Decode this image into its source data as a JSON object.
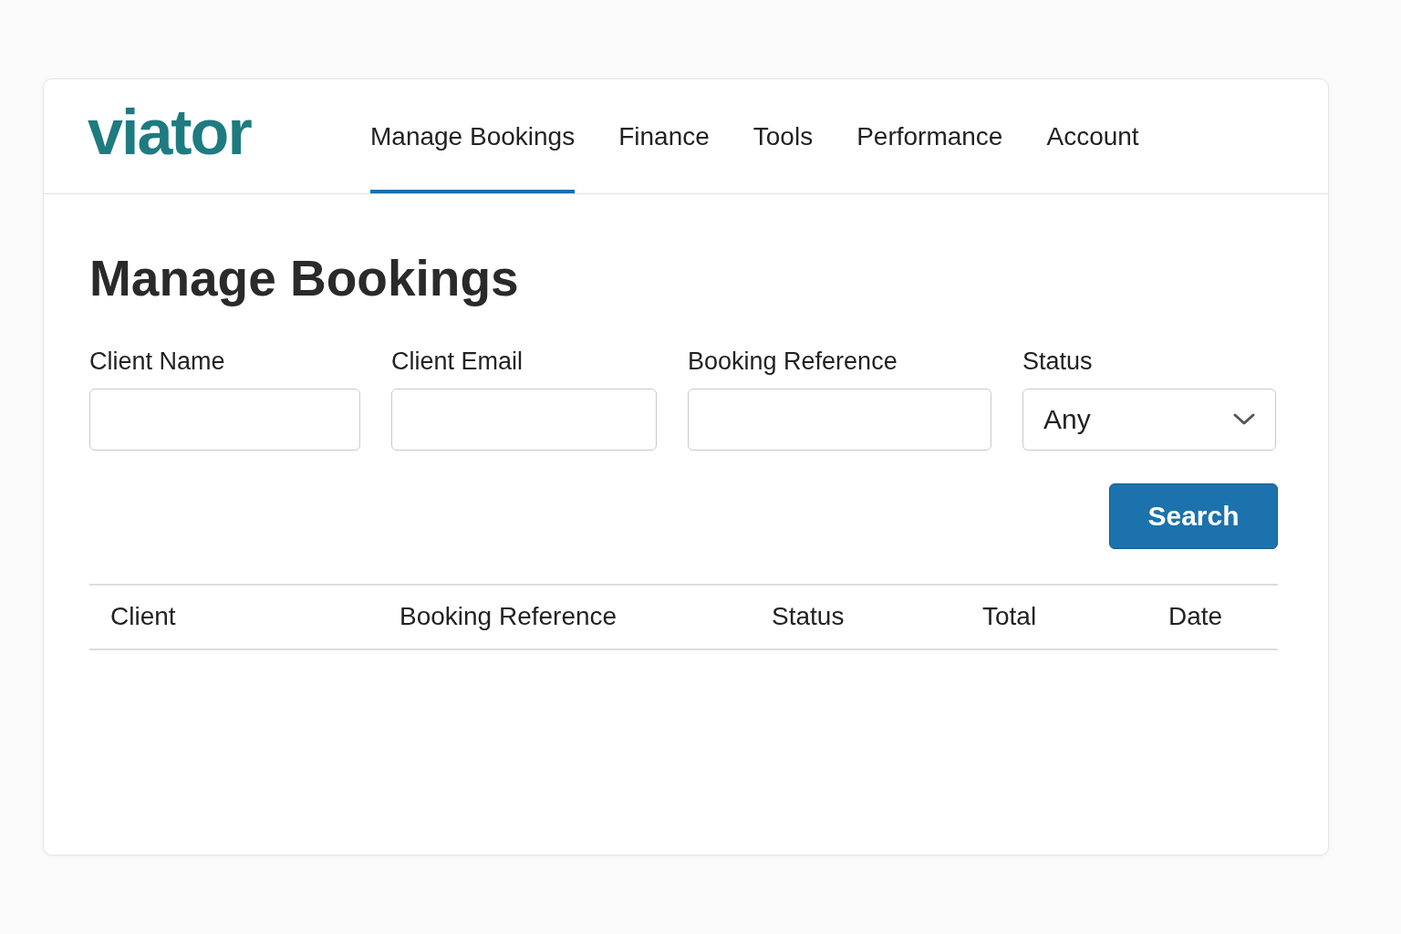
{
  "logo": "viator",
  "nav": [
    {
      "label": "Manage Bookings",
      "selected": true
    },
    {
      "label": "Finance",
      "selected": false
    },
    {
      "label": "Tools",
      "selected": false
    },
    {
      "label": "Performance",
      "selected": false
    },
    {
      "label": "Account",
      "selected": false
    }
  ],
  "title": "Manage Bookings",
  "filters": [
    {
      "kind": "text",
      "label": "Client Name"
    },
    {
      "kind": "text",
      "label": "Client Email"
    },
    {
      "kind": "text",
      "label": "Booking Reference"
    },
    {
      "kind": "select",
      "label": "Status",
      "value": "Any"
    }
  ],
  "search_button": "Search",
  "table": {
    "columns": [
      "Client",
      "Booking Reference",
      "Status",
      "Total",
      "Date"
    ]
  }
}
